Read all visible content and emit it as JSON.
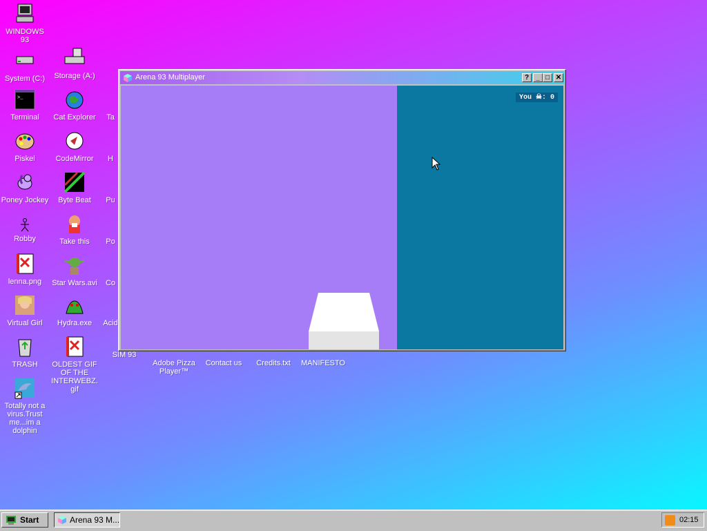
{
  "desktop": {
    "icons": [
      {
        "label": "WINDOWS 93"
      },
      {
        "label": "System (C:)"
      },
      {
        "label": "Storage (A:)"
      },
      {
        "label": "Terminal"
      },
      {
        "label": "Cat Explorer"
      },
      {
        "label": "Ta"
      },
      {
        "label": "Piskel"
      },
      {
        "label": "CodeMirror"
      },
      {
        "label": "H"
      },
      {
        "label": "Poney Jockey"
      },
      {
        "label": "Byte Beat"
      },
      {
        "label": "Pu"
      },
      {
        "label": "Robby"
      },
      {
        "label": "Take this"
      },
      {
        "label": "Po"
      },
      {
        "label": "lenna.png"
      },
      {
        "label": "Star Wars.avi"
      },
      {
        "label": "Co"
      },
      {
        "label": "Virtual Girl"
      },
      {
        "label": "Hydra.exe"
      },
      {
        "label": "Acid"
      },
      {
        "label": "TRASH"
      },
      {
        "label": "OLDEST GIF OF THE INTERWEBZ.gif"
      },
      {
        "label": "SIM 93"
      },
      {
        "label": "Adobe Pizza Player™"
      },
      {
        "label": "Contact us"
      },
      {
        "label": "Credits.txt"
      },
      {
        "label": "MANIFESTO"
      },
      {
        "label": "Totally not a virus.Trust me...im a dolphin"
      }
    ]
  },
  "window": {
    "title": "Arena 93 Multiplayer",
    "buttons": {
      "help": "?",
      "minimize": "_",
      "maximize": "□",
      "close": "✕"
    },
    "score_label": "You ☠: 0"
  },
  "taskbar": {
    "start_label": "Start",
    "task_label": "Arena 93 M...",
    "clock": "02:15"
  },
  "colors": {
    "sky": "#a77cf7",
    "wall": "#0a78a0",
    "desktop_gradient": [
      "#ff00ff",
      "#b44cff",
      "#6f8dff",
      "#00ffff"
    ]
  }
}
